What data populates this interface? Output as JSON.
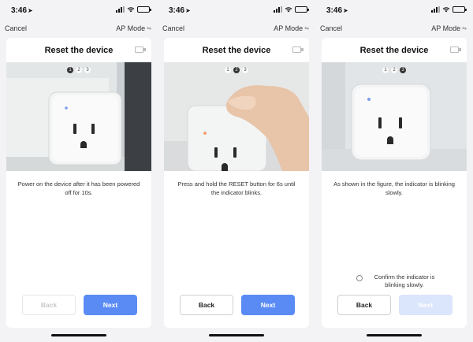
{
  "status": {
    "time": "3:46"
  },
  "nav": {
    "cancel": "Cancel",
    "mode": "AP Mode"
  },
  "screens": [
    {
      "title": "Reset the device",
      "steps": [
        "1",
        "2",
        "3"
      ],
      "active_step": 1,
      "description": "Power on the device after it has been powered off for 10s.",
      "back_label": "Back",
      "next_label": "Next"
    },
    {
      "title": "Reset the device",
      "steps": [
        "1",
        "2",
        "3"
      ],
      "active_step": 2,
      "description": "Press and hold the RESET button for 6s until the indicator blinks.",
      "back_label": "Back",
      "next_label": "Next"
    },
    {
      "title": "Reset the device",
      "steps": [
        "1",
        "2",
        "3"
      ],
      "active_step": 3,
      "description": "As shown in the figure, the indicator is blinking slowly.",
      "confirm_label": "Confirm the indicator is blinking slowly.",
      "back_label": "Back",
      "next_label": "Next"
    }
  ],
  "colors": {
    "primary": "#5a8bf5",
    "primary_disabled": "#dbe5fb",
    "battery": "#3ec24a"
  }
}
